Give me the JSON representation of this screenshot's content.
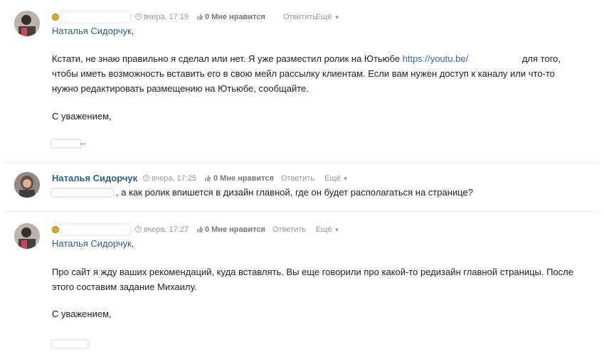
{
  "comments": [
    {
      "author_name": "",
      "author_redacted": true,
      "time": "вчера, 17:19",
      "likes": "0 Мне нравится",
      "reply": "Ответить",
      "more": "Ещё",
      "addressee": "Наталья Сидорчук,",
      "body_lines": [
        "Кстати, не знаю правильно я сделал или нет. Я уже разместил ролик на Ютьюбе",
        "чтобы иметь возможность вставить его в свою мейл рассылку клиентам. Если вам нужен доступ к каналу или что-то",
        "нужно редактировать размещению на Ютьюбе, сообщайте."
      ],
      "link_text": "https://youtu.be/",
      "after_link": "для того,",
      "closing": "С уважением,",
      "signature_tail": "..."
    },
    {
      "author_name": "Наталья Сидорчук",
      "author_redacted": false,
      "time": "вчера, 17:25",
      "likes": "0 Мне нравится",
      "reply": "Ответить",
      "more": "Ещё",
      "body": ", а как ролик впишется в дизайн главной, где он будет располагаться на странице?"
    },
    {
      "author_name": "",
      "author_redacted": true,
      "time": "вчера, 17:27",
      "likes": "0 Мне нравится",
      "reply": "Ответить",
      "more": "Ещё",
      "addressee": "Наталья Сидорчук,",
      "body_lines": [
        "Про сайт я жду ваших рекомендаций, куда вставлять. Вы еще говорили про какой-то редизайн главной страницы. После",
        "этого составим задание Михаилу."
      ],
      "closing": "С уважением,"
    }
  ],
  "icons": {
    "badge": "moderator-badge-icon",
    "clock": "clock-icon",
    "like": "thumbs-up-icon",
    "more": "caret-down-icon"
  },
  "colors": {
    "link": "#2f6fb2",
    "author": "#2f5d8f",
    "meta": "#999999",
    "badge": "#d9a928"
  }
}
